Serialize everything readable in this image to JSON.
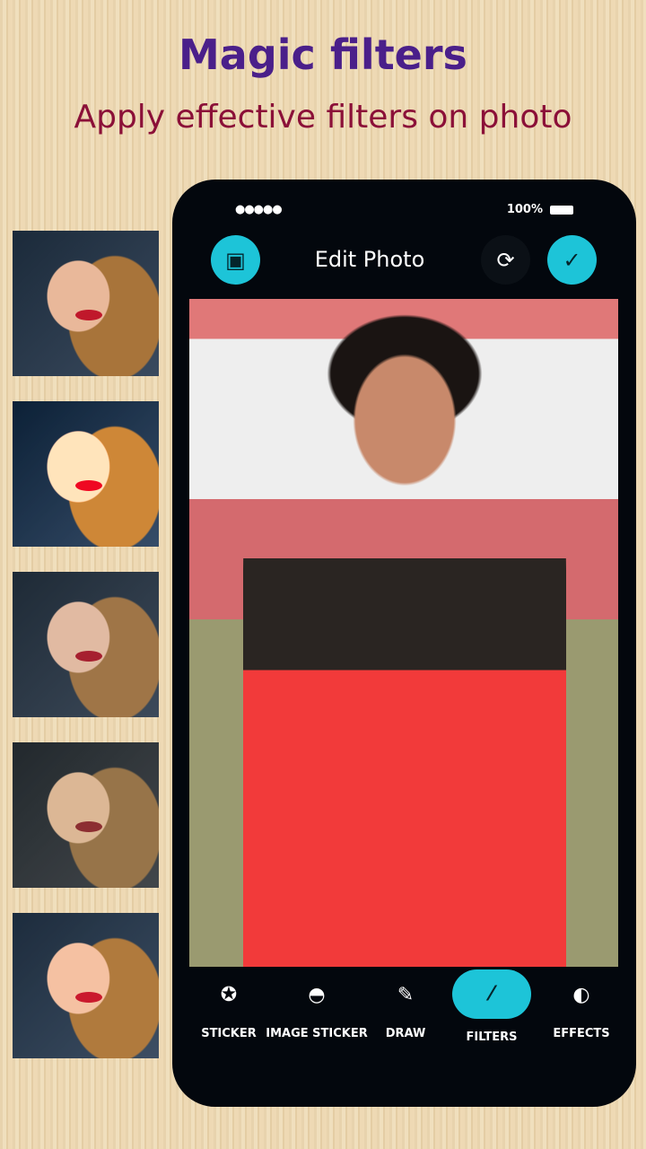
{
  "header": {
    "title": "Magic filters",
    "subtitle": "Apply effective filters on photo"
  },
  "thumbnails": [
    "filter-1",
    "filter-2",
    "filter-3",
    "filter-4",
    "filter-5"
  ],
  "status": {
    "signal": "●●●●●",
    "battery": "100%"
  },
  "toolbar": {
    "title": "Edit Photo",
    "left_icon": "image-edit-icon",
    "refresh_icon": "refresh-icon",
    "confirm_icon": "check-icon",
    "accent": "#1dc4d8"
  },
  "nav": [
    {
      "label": "STICKER",
      "icon": "sticker-icon",
      "glyph": "✪"
    },
    {
      "label": "IMAGE STICKER",
      "icon": "image-sticker-icon",
      "glyph": "◓"
    },
    {
      "label": "DRAW",
      "icon": "pencil-icon",
      "glyph": "✎"
    },
    {
      "label": "FILTERS",
      "icon": "magic-wand-icon",
      "glyph": "⁄",
      "active": true
    },
    {
      "label": "EFFECTS",
      "icon": "contrast-icon",
      "glyph": "◐"
    }
  ]
}
